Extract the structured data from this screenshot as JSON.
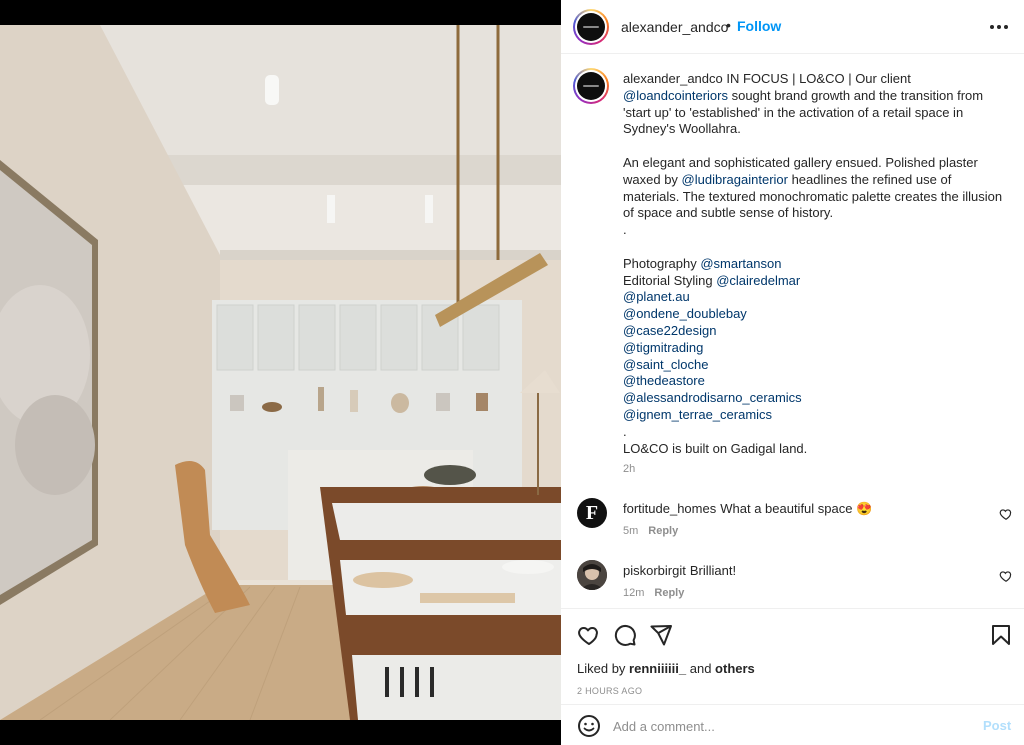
{
  "post": {
    "username": "alexander_andco",
    "dot": "•",
    "follow_label": "Follow",
    "caption": {
      "p1_a": " IN FOCUS | LO&CO | Our client ",
      "m_loandco": "@loandcointeriors",
      "p1_b": " sought brand growth and the transition from 'start up' to 'established' in the activation of a retail space in Sydney's Woollahra.\n\nAn elegant and sophisticated gallery ensued. Polished plaster waxed by ",
      "m_ludibraga": "@ludibragainterior",
      "p2_b": " headlines the refined use of materials. The textured monochromatic palette creates the illusion of space and subtle sense of history.\n.\n\nPhotography ",
      "m_smartanson": "@smartanson",
      "p3_b": "\nEditorial Styling ",
      "m_claire": "@clairedelmar",
      "mentions": [
        "@planet.au",
        "@ondene_doublebay",
        "@case22design",
        "@tigmitrading",
        "@saint_cloche",
        "@thedeastore",
        "@alessandrodisarno_ceramics",
        "@ignem_terrae_ceramics"
      ],
      "end": ".\nLO&CO is built on Gadigal land."
    },
    "caption_time": "2h"
  },
  "comments": [
    {
      "user": "fortitude_homes",
      "text": "What a beautiful space 😍",
      "time": "5m",
      "reply_label": "Reply",
      "avatar_letter": "F"
    },
    {
      "user": "piskorbirgit",
      "text": "Brilliant!",
      "time": "12m",
      "reply_label": "Reply"
    }
  ],
  "actions": {
    "liked_prefix": "Liked by ",
    "liked_user": "renniiiiii_",
    "liked_and": " and ",
    "liked_others": "others",
    "posted_ago": "2 HOURS AGO",
    "comment_placeholder": "Add a comment...",
    "post_label": "Post"
  },
  "colors": {
    "link": "#0095f6",
    "mention": "#00376b",
    "post_disabled": "#b2dffc"
  },
  "icons": [
    "more-icon",
    "heart-icon",
    "comment-icon",
    "share-icon",
    "save-icon",
    "emoji-icon"
  ]
}
